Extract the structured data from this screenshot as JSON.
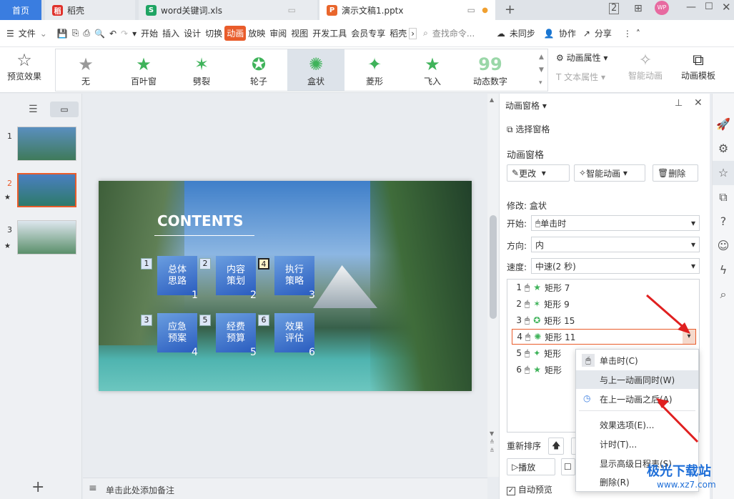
{
  "tabs": {
    "home": "首页",
    "doc": "稻壳",
    "xls": "word关键词.xls",
    "ppt": "演示文稿1.pptx"
  },
  "menu": {
    "file": "文件",
    "items": [
      "开始",
      "插入",
      "设计",
      "切换",
      "动画",
      "放映",
      "审阅",
      "视图",
      "开发工具",
      "会员专享",
      "稻壳"
    ],
    "search": "查找命令...",
    "sync": "未同步",
    "collab": "协作",
    "share": "分享"
  },
  "ribbon": {
    "preview": "预览效果",
    "effects": [
      "无",
      "百叶窗",
      "劈裂",
      "轮子",
      "盒状",
      "菱形",
      "飞入",
      "动态数字"
    ],
    "anim_props": "动画属性",
    "text_props": "文本属性",
    "smart_anim": "智能动画",
    "anim_template": "动画模板"
  },
  "slides": [
    "1",
    "2",
    "3"
  ],
  "slide": {
    "title": "CONTENTS",
    "boxes": [
      {
        "n": "1",
        "label": "总体\n思路",
        "big": "1"
      },
      {
        "n": "2",
        "label": "内容\n策划",
        "big": "2"
      },
      {
        "n": "4",
        "label": "执行\n策略",
        "big": "3"
      },
      {
        "n": "3",
        "label": "应急\n预案",
        "big": "4"
      },
      {
        "n": "5",
        "label": "经费\n预算",
        "big": "5"
      },
      {
        "n": "6",
        "label": "效果\n评估",
        "big": "6"
      }
    ]
  },
  "notes": "单击此处添加备注",
  "panel": {
    "header": "动画窗格",
    "select_pane": "选择窗格",
    "section": "动画窗格",
    "change": "更改",
    "smart": "智能动画",
    "delete": "删除",
    "modify": "修改: 盒状",
    "start_label": "开始:",
    "start_val": "单击时",
    "dir_label": "方向:",
    "dir_val": "内",
    "speed_label": "速度:",
    "speed_val": "中速(2 秒)",
    "list": [
      {
        "n": "1",
        "name": "矩形 7"
      },
      {
        "n": "2",
        "name": "矩形 9"
      },
      {
        "n": "3",
        "name": "矩形 15"
      },
      {
        "n": "4",
        "name": "矩形 11"
      },
      {
        "n": "5",
        "name": "矩形"
      },
      {
        "n": "6",
        "name": "矩形"
      }
    ],
    "reorder": "重新排序",
    "play": "播放",
    "autopreview": "自动预览"
  },
  "context": [
    "单击时(C)",
    "与上一动画同时(W)",
    "在上一动画之后(A)",
    "效果选项(E)...",
    "计时(T)...",
    "显示高级日程表(S)",
    "删除(R)"
  ],
  "watermark": "极光下载站",
  "watermark_url": "www.xz7.com"
}
